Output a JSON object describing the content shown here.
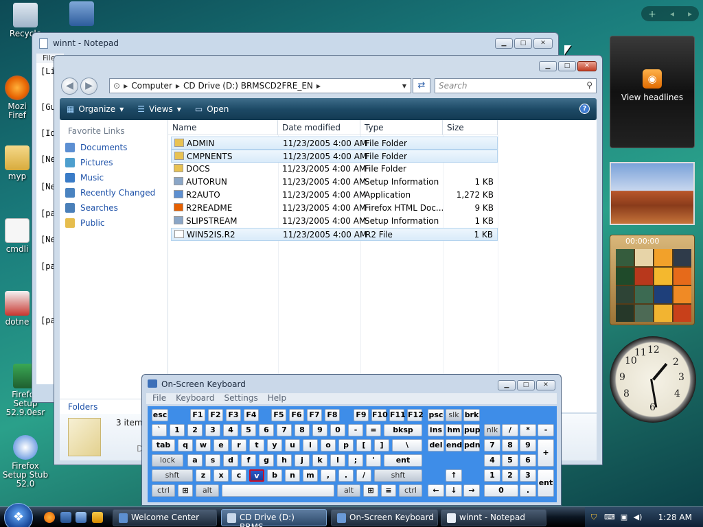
{
  "desktop": {
    "icons": [
      {
        "name": "recycle-bin",
        "label": "Recycle",
        "color": "#b7c7d8"
      },
      {
        "name": "mozilla-firefox",
        "label": "Mozi Firef",
        "color": "#e66000"
      },
      {
        "name": "mypc",
        "label": "myp",
        "color": "#e9c36b"
      },
      {
        "name": "cmdline",
        "label": "cmdli",
        "color": "#f0f0f0"
      },
      {
        "name": "dotnet",
        "label": "dotne",
        "color": "#c8362f"
      },
      {
        "name": "firefox-setup-esr",
        "label": "Firefox Setup 52.9.0esr",
        "color": "#2b7a3d"
      },
      {
        "name": "firefox-setup-stub",
        "label": "Firefox Setup Stub 52.0",
        "color": "#3d7bd8"
      }
    ]
  },
  "notepad": {
    "title": "winnt - Notepad",
    "menu_file": "File",
    "lines": [
      "[Li",
      "[Gu",
      "[Id",
      "[Ne",
      "[Ne",
      "[pa",
      "[Ne",
      "[pa",
      "[pa"
    ]
  },
  "explorer": {
    "address": [
      "Computer",
      "CD Drive (D:) BRMSCD2FRE_EN"
    ],
    "search_placeholder": "Search",
    "toolbar": {
      "organize": "Organize",
      "views": "Views",
      "open": "Open"
    },
    "favorites_header": "Favorite Links",
    "favorites": [
      {
        "label": "Documents",
        "color": "#5c8fd2"
      },
      {
        "label": "Pictures",
        "color": "#4e9fce"
      },
      {
        "label": "Music",
        "color": "#3a7cc7"
      },
      {
        "label": "Recently Changed",
        "color": "#4a83c0"
      },
      {
        "label": "Searches",
        "color": "#4a7fb8"
      },
      {
        "label": "Public",
        "color": "#e6bd4d"
      }
    ],
    "folders_label": "Folders",
    "columns": [
      "Name",
      "Date modified",
      "Type",
      "Size"
    ],
    "rows": [
      {
        "name": "ADMIN",
        "date": "11/23/2005 4:00 AM",
        "type": "File Folder",
        "size": "",
        "icon": "folder",
        "selected": true
      },
      {
        "name": "CMPNENTS",
        "date": "11/23/2005 4:00 AM",
        "type": "File Folder",
        "size": "",
        "icon": "folder",
        "selected": true
      },
      {
        "name": "DOCS",
        "date": "11/23/2005 4:00 AM",
        "type": "File Folder",
        "size": "",
        "icon": "folder",
        "selected": false
      },
      {
        "name": "AUTORUN",
        "date": "11/23/2005 4:00 AM",
        "type": "Setup Information",
        "size": "1 KB",
        "icon": "setup",
        "selected": false
      },
      {
        "name": "R2AUTO",
        "date": "11/23/2005 4:00 AM",
        "type": "Application",
        "size": "1,272 KB",
        "icon": "app",
        "selected": false
      },
      {
        "name": "R2README",
        "date": "11/23/2005 4:00 AM",
        "type": "Firefox HTML Doc...",
        "size": "9 KB",
        "icon": "html",
        "selected": false
      },
      {
        "name": "SLIPSTREAM",
        "date": "11/23/2005 4:00 AM",
        "type": "Setup Information",
        "size": "1 KB",
        "icon": "setup",
        "selected": false
      },
      {
        "name": "WIN52IS.R2",
        "date": "11/23/2005 4:00 AM",
        "type": "R2 File",
        "size": "1 KB",
        "icon": "file",
        "selected": true
      }
    ],
    "details_text": "3 item",
    "details_sub": "D"
  },
  "sidebar": {
    "news_label": "View headlines",
    "puzzle_time": "00:00:00"
  },
  "osk": {
    "title": "On-Screen Keyboard",
    "menu": [
      "File",
      "Keyboard",
      "Settings",
      "Help"
    ]
  },
  "taskbar": {
    "tasks": [
      {
        "label": "Welcome Center",
        "active": false,
        "color": "#5d8fd0"
      },
      {
        "label": "CD Drive (D:) BRMS...",
        "active": true,
        "color": "#c9d8ea"
      },
      {
        "label": "On-Screen Keyboard",
        "active": false,
        "color": "#6a9ad8"
      },
      {
        "label": "winnt - Notepad",
        "active": false,
        "color": "#e8eef6"
      }
    ],
    "time": "1:28 AM"
  },
  "colors": {
    "accent": "#3e8de8",
    "highlight_key": "#c4102c",
    "selection": "#d9ebf9"
  }
}
